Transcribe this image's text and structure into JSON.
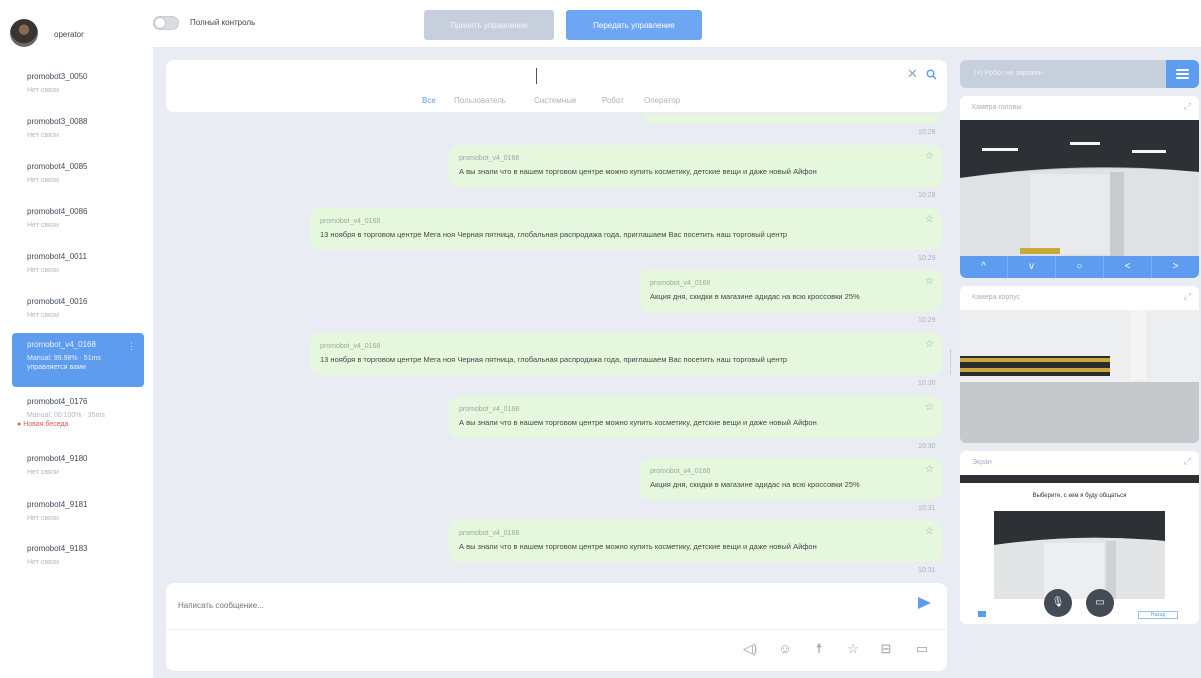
{
  "header": {
    "username": "operator",
    "toggle_label": "Полный контроль",
    "take_control": "Принять управление",
    "give_control": "Передать управление"
  },
  "robots": [
    {
      "name": "promobot3_0050",
      "status": "Нет связи"
    },
    {
      "name": "promobot3_0088",
      "status": "Нет связи"
    },
    {
      "name": "promobot4_0085",
      "status": "Нет связи"
    },
    {
      "name": "promobot4_0086",
      "status": "Нет связи"
    },
    {
      "name": "promobot4_0011",
      "status": "Нет связи"
    },
    {
      "name": "promobot4_0016",
      "status": "Нет связи"
    },
    {
      "name": "promobot_v4_0168",
      "status": "Manual: 99.98% · 51ms",
      "status2": "управляется вами",
      "active": true
    },
    {
      "name": "promobot4_0176",
      "status": "Manual: 00:100% · 35ms",
      "new_chat": "Новая беседа"
    },
    {
      "name": "promobot4_9180",
      "status": "Нет связи"
    },
    {
      "name": "promobot4_9181",
      "status": "Нет связи"
    },
    {
      "name": "promobot4_9183",
      "status": "Нет связи"
    }
  ],
  "search": {
    "placeholder": "",
    "filters": [
      "Все",
      "Пользователь",
      "Системные",
      "Робот",
      "Оператор"
    ]
  },
  "messages": [
    {
      "author": "promobot_v4_0168",
      "text": "А вы знали что в нашем торговом центре можно купить косметику, детские вещи и даже новый Айфон",
      "time": "10:28"
    },
    {
      "author": "promobot_v4_0168",
      "text": "13 ноября в торговом центре Мега ноя Черная пятница, глобальная распродажа года, приглашаем Вас посетить наш торговый центр",
      "time": "10:29"
    },
    {
      "author": "promobot_v4_0168",
      "text": "Акция дня, скидки в магазине адидас на всю кроссовки 25%",
      "time": "10:29"
    },
    {
      "author": "promobot_v4_0168",
      "text": "13 ноября в торговом центре Мега ноя Черная пятница, глобальная распродажа года, приглашаем Вас посетить наш торговый центр",
      "time": "10:30"
    },
    {
      "author": "promobot_v4_0168",
      "text": "А вы знали что в нашем торговом центре можно купить косметику, детские вещи и даже новый Айфон",
      "time": "10:30"
    },
    {
      "author": "promobot_v4_0168",
      "text": "Акция дня, скидки в магазине адидас на всю кроссовки 25%",
      "time": "10:31"
    },
    {
      "author": "promobot_v4_0168",
      "text": "А вы знали что в нашем торговом центре можно купить косметику, детские вещи и даже новый Айфон",
      "time": "10:31"
    }
  ],
  "first_time": "10:28",
  "compose": {
    "placeholder": "Написать сообщение..."
  },
  "right": {
    "robot_status": "Робот не заряжен",
    "cam_head": "Камера головы",
    "cam_body": "Камера корпус",
    "screen": "Экран",
    "screen_text": "Выберите, с кем я буду общаться",
    "screen_btn": "Назад"
  },
  "colors": {
    "accent": "#5e9cf0",
    "bubble": "#e5f8de",
    "bg": "#e9edf3"
  }
}
